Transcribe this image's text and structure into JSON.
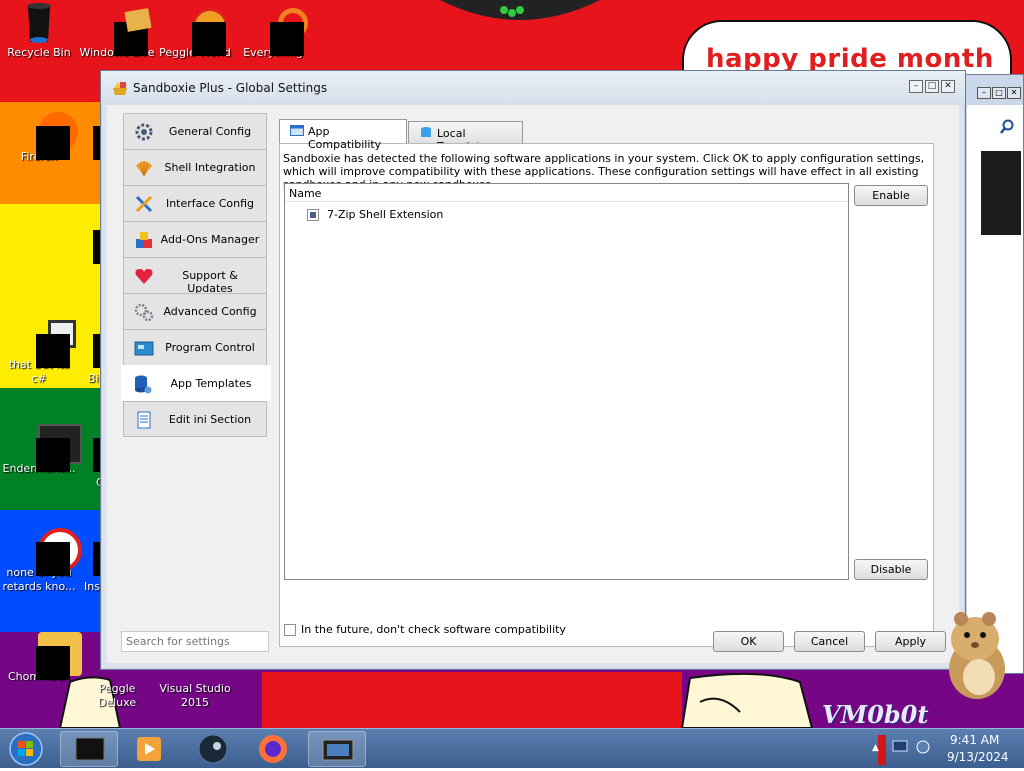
{
  "desktop": {
    "bubble_text": "happy pride month",
    "corner_text": "VM0b0t",
    "icons": [
      {
        "label": "Recycle Bin",
        "icon": "recycle-bin-icon"
      },
      {
        "label": "Windows Live",
        "icon": "windows-live-icon"
      },
      {
        "label": "Peggle World",
        "icon": "peggle-world-icon"
      },
      {
        "label": "Everything",
        "icon": "everything-search-icon"
      },
      {
        "label": "Firefox",
        "icon": "firefox-icon"
      },
      {
        "label": "that but its c#",
        "icon": "folder-shortcut-icon"
      },
      {
        "label": "Endermanc...",
        "icon": "app-icon"
      },
      {
        "label": "none of you retards kno...",
        "icon": "app-icon"
      },
      {
        "label": "ChomikBox",
        "icon": "chomikbox-icon"
      },
      {
        "label": "Peggle Deluxe",
        "icon": "peggle-deluxe-icon"
      },
      {
        "label": "Visual Studio 2015",
        "icon": "visual-studio-icon"
      }
    ],
    "partial_labels": [
      "Bi",
      "C",
      "Ins"
    ]
  },
  "window": {
    "title": "Sandboxie Plus - Global Settings",
    "controls": {
      "minimize": "–",
      "maximize": "□",
      "close": "✕"
    },
    "nav": [
      {
        "label": "General Config",
        "icon": "gear-icon"
      },
      {
        "label": "Shell Integration",
        "icon": "shell-icon"
      },
      {
        "label": "Interface Config",
        "icon": "interface-icon"
      },
      {
        "label": "Add-Ons Manager",
        "icon": "puzzle-icon"
      },
      {
        "label": "Support & Updates",
        "icon": "heart-icon"
      },
      {
        "label": "Advanced Config",
        "icon": "gears-icon"
      },
      {
        "label": "Program Control",
        "icon": "program-icon"
      },
      {
        "label": "App Templates",
        "icon": "database-icon"
      },
      {
        "label": "Edit ini Section",
        "icon": "document-icon"
      }
    ],
    "active_nav": "App Templates",
    "tabs": [
      {
        "label": "App Compatibility",
        "active": true
      },
      {
        "label": "Local Templates",
        "active": false
      }
    ],
    "description": "Sandboxie has detected the following software applications in your system. Click OK to apply configuration settings, which will improve compatibility with these applications. These configuration settings will have effect in all existing sandboxes and in any new sandboxes.",
    "list": {
      "header": "Name",
      "items": [
        {
          "label": "7-Zip Shell Extension",
          "state": "partial"
        }
      ]
    },
    "enable_button": "Enable",
    "disable_button": "Disable",
    "future_check_label": "In the future, don't check software compatibility",
    "search_placeholder": "Search for settings",
    "ok_button": "OK",
    "cancel_button": "Cancel",
    "apply_button": "Apply"
  },
  "taskbar": {
    "time": "9:41 AM",
    "date": "9/13/2024",
    "items": [
      "terminal-icon",
      "media-player-icon",
      "steam-icon",
      "firefox-icon",
      "sandboxie-icon"
    ]
  },
  "colors": {
    "accent": "#3c5f8f",
    "stripe_red": "#e8141b",
    "stripe_orange": "#ff8c00",
    "stripe_yellow": "#ffed00",
    "stripe_green": "#008126",
    "stripe_blue": "#004dff",
    "stripe_purple": "#750787"
  }
}
